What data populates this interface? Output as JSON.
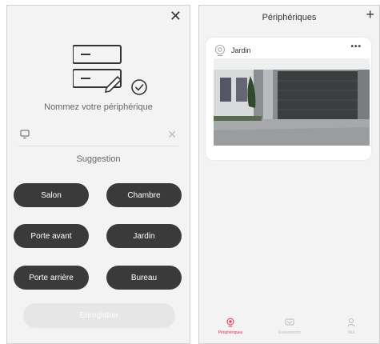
{
  "left": {
    "close_glyph": "✕",
    "name_title": "Nommez votre périphérique",
    "input_value": "",
    "input_placeholder": "",
    "clear_glyph": "✕",
    "suggestion_title": "Suggestion",
    "suggestions": [
      "Salon",
      "Chambre",
      "Porte avant",
      "Jardin",
      "Porte arrière",
      "Bureau"
    ],
    "save_label": "Enregistrer"
  },
  "right": {
    "title": "Périphériques",
    "add_glyph": "+",
    "device": {
      "name": "Jardin",
      "more_glyph": "•••"
    },
    "tabs": [
      {
        "label": "Périphériques",
        "icon": "camera-icon"
      },
      {
        "label": "Événements",
        "icon": "events-icon"
      },
      {
        "label": "Moi",
        "icon": "person-icon"
      }
    ]
  },
  "colors": {
    "accent": "#e0304a",
    "chip": "#3a3a3a",
    "background": "#f3f3f3"
  }
}
